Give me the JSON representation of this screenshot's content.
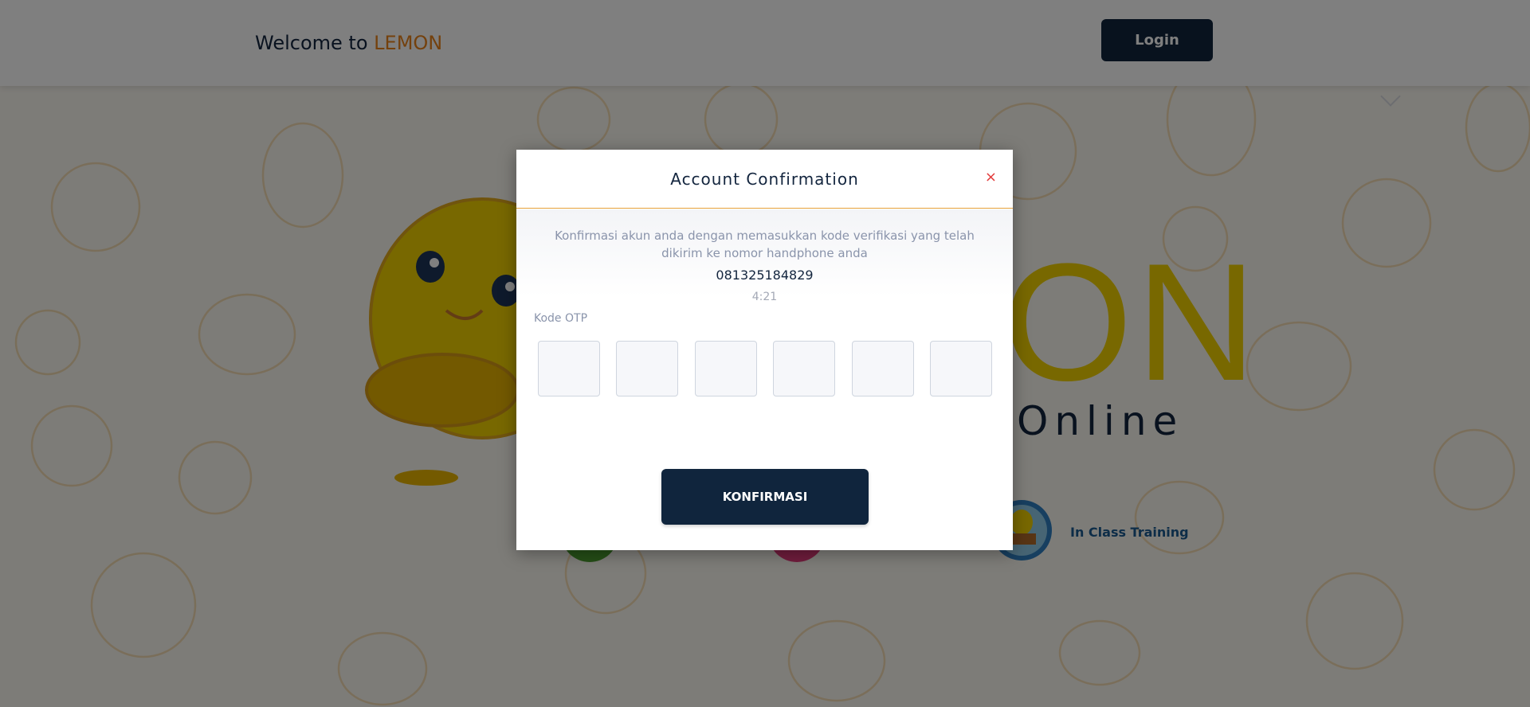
{
  "header": {
    "welcome_text": "Welcome to",
    "brand_name": "LEMON",
    "login_label": "Login"
  },
  "hero": {
    "letters": "ON",
    "subtitle": "Online",
    "feature_label": "In Class Training"
  },
  "modal": {
    "title": "Account Confirmation",
    "close_label": "×",
    "description": "Konfirmasi akun anda dengan memasukkan kode verifikasi yang telah dikirim ke nomor handphone anda",
    "phone": "081325184829",
    "timer": "4:21",
    "otp_label": "Kode OTP",
    "otp_values": [
      "",
      "",
      "",
      "",
      "",
      ""
    ],
    "confirm_label": "KONFIRMASI"
  },
  "colors": {
    "brand_orange": "#e8821a",
    "navy": "#10253d",
    "lemon_yellow": "#f1d100",
    "close_red": "#e23a3a"
  }
}
